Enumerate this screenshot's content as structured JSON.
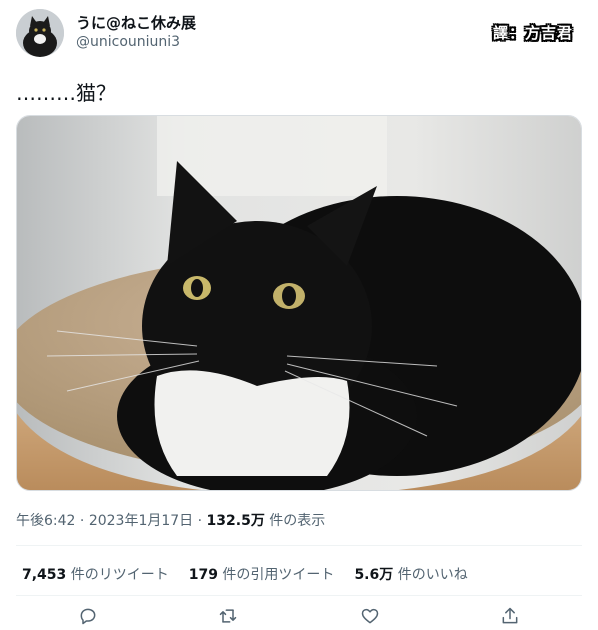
{
  "author": {
    "name": "うに@ねこ休み展",
    "handle": "@unicouniuni3"
  },
  "watermark": "譯：方吉君",
  "tweet": {
    "text": "………猫？"
  },
  "meta": {
    "time": "午後6:42",
    "separator1": " · ",
    "date": "2023年1月17日",
    "separator2": " · ",
    "views_count": "132.5万",
    "views_label": " 件の表示"
  },
  "stats": [
    {
      "count": "7,453",
      "label": " 件のリツイート"
    },
    {
      "count": "179",
      "label": " 件の引用ツイート"
    },
    {
      "count": "5.6万",
      "label": " 件のいいね"
    }
  ],
  "actions": [
    "reply-icon",
    "retweet-icon",
    "like-icon",
    "share-icon"
  ],
  "colors": {
    "text": "#0f1419",
    "secondary": "#536471",
    "divider": "#eff3f4"
  }
}
